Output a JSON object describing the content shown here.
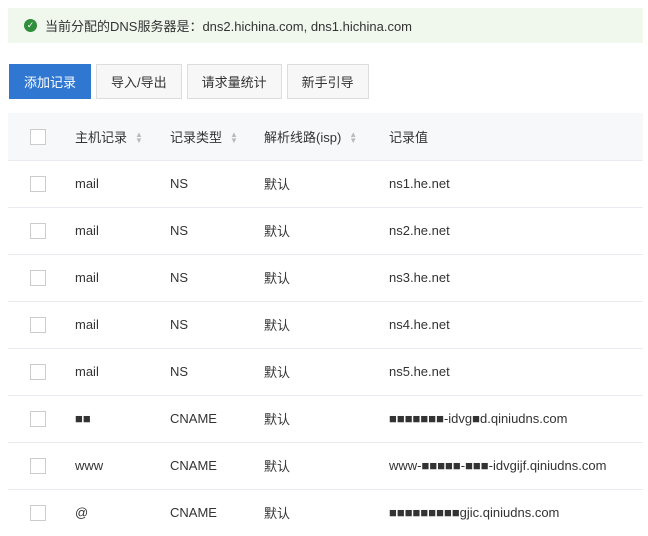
{
  "banner": {
    "icon": "check-circle-icon",
    "text": "当前分配的DNS服务器是：dns2.hichina.com, dns1.hichina.com"
  },
  "toolbar": {
    "add": "添加记录",
    "import_export": "导入/导出",
    "stats": "请求量统计",
    "guide": "新手引导"
  },
  "table": {
    "headers": {
      "host": "主机记录",
      "type": "记录类型",
      "line": "解析线路(isp)",
      "value": "记录值"
    },
    "rows": [
      {
        "host": "mail",
        "type": "NS",
        "line": "默认",
        "value": "ns1.he.net"
      },
      {
        "host": "mail",
        "type": "NS",
        "line": "默认",
        "value": "ns2.he.net"
      },
      {
        "host": "mail",
        "type": "NS",
        "line": "默认",
        "value": "ns3.he.net"
      },
      {
        "host": "mail",
        "type": "NS",
        "line": "默认",
        "value": "ns4.he.net"
      },
      {
        "host": "mail",
        "type": "NS",
        "line": "默认",
        "value": "ns5.he.net"
      },
      {
        "host": "■■",
        "type": "CNAME",
        "line": "默认",
        "value": "■■■■■■■-idvg■d.qiniudns.com"
      },
      {
        "host": "www",
        "type": "CNAME",
        "line": "默认",
        "value": "www-■■■■■-■■■-idvgijf.qiniudns.com"
      },
      {
        "host": "@",
        "type": "CNAME",
        "line": "默认",
        "value": "■■■■■■■■■gjic.qiniudns.com"
      }
    ]
  },
  "colors": {
    "primary": "#2f77d1",
    "success": "#2f8f3a"
  }
}
